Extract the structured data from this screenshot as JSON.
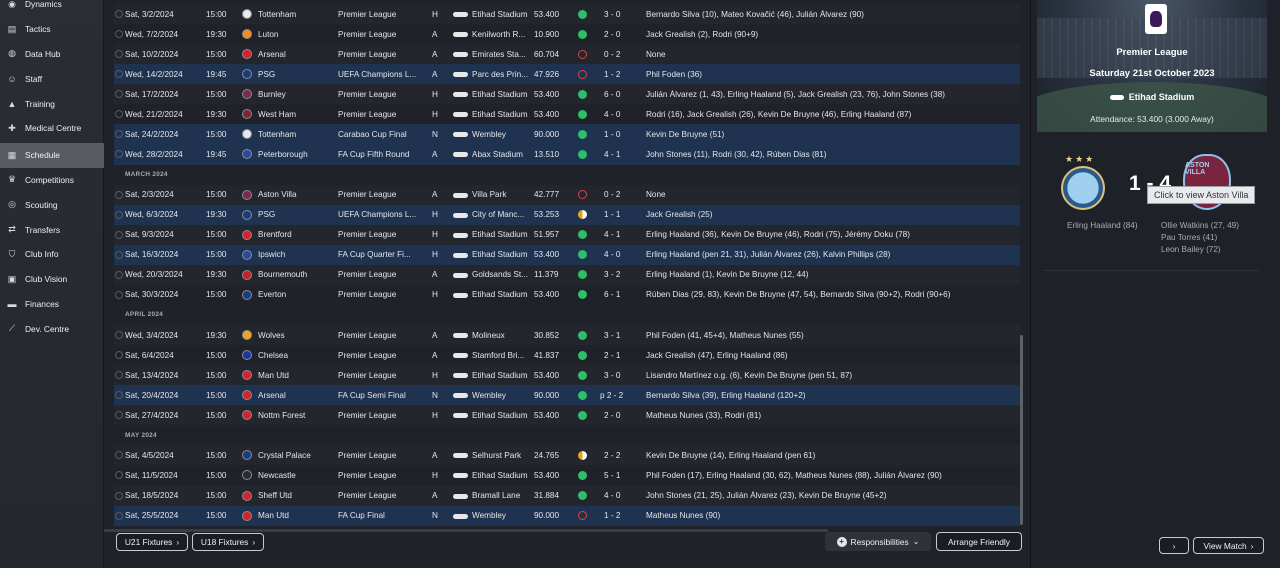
{
  "sidebar": {
    "items": [
      {
        "label": "Dynamics",
        "icon": "dynamics-icon"
      },
      {
        "label": "Tactics",
        "icon": "tactics-icon"
      },
      {
        "label": "Data Hub",
        "icon": "data-hub-icon"
      },
      {
        "label": "Staff",
        "icon": "staff-icon"
      },
      {
        "label": "Training",
        "icon": "training-icon"
      },
      {
        "label": "Medical Centre",
        "icon": "medical-icon"
      },
      {
        "label": "Schedule",
        "icon": "calendar-icon"
      },
      {
        "label": "Competitions",
        "icon": "trophy-icon"
      },
      {
        "label": "Scouting",
        "icon": "scouting-icon"
      },
      {
        "label": "Transfers",
        "icon": "transfers-icon"
      },
      {
        "label": "Club Info",
        "icon": "shield-icon"
      },
      {
        "label": "Club Vision",
        "icon": "vision-icon"
      },
      {
        "label": "Finances",
        "icon": "finances-icon"
      },
      {
        "label": "Dev. Centre",
        "icon": "dev-centre-icon"
      }
    ],
    "active": "Schedule"
  },
  "fixtures": [
    {
      "type": "match",
      "day": "Sat, 3/2/2024",
      "time": "15:00",
      "opp": "Tottenham",
      "comp": "Premier League",
      "ha": "H",
      "stadium": "Etihad Stadium",
      "att": "53.400",
      "result": "W",
      "score": "3 - 0",
      "scorers": "Bernardo Silva (10), Mateo Kovačić (46), Julián Álvarez (90)",
      "crest": "#e8e8f0"
    },
    {
      "type": "match",
      "day": "Wed, 7/2/2024",
      "time": "19:30",
      "opp": "Luton",
      "comp": "Premier League",
      "ha": "A",
      "stadium": "Kenilworth R...",
      "att": "10.900",
      "result": "W",
      "score": "2 - 0",
      "scorers": "Jack Grealish (2), Rodri (90+9)",
      "crest": "#f58a1f"
    },
    {
      "type": "match",
      "day": "Sat, 10/2/2024",
      "time": "15:00",
      "opp": "Arsenal",
      "comp": "Premier League",
      "ha": "A",
      "stadium": "Emirates Sta...",
      "att": "60.704",
      "result": "L",
      "score": "0 - 2",
      "scorers": "None",
      "crest": "#d8202a"
    },
    {
      "type": "match",
      "day": "Wed, 14/2/2024",
      "time": "19:45",
      "opp": "PSG",
      "comp": "UEFA Champions L...",
      "ha": "A",
      "stadium": "Parc des Prin...",
      "att": "47.926",
      "result": "L",
      "score": "1 - 2",
      "scorers": "Phil Foden (36)",
      "crest": "#1c3c78",
      "hl": true
    },
    {
      "type": "match",
      "day": "Sat, 17/2/2024",
      "time": "15:00",
      "opp": "Burnley",
      "comp": "Premier League",
      "ha": "H",
      "stadium": "Etihad Stadium",
      "att": "53.400",
      "result": "W",
      "score": "6 - 0",
      "scorers": "Julián Álvarez (1, 43), Erling Haaland (5), Jack Grealish (23, 76), John Stones (38)",
      "crest": "#7a2a4a"
    },
    {
      "type": "match",
      "day": "Wed, 21/2/2024",
      "time": "19:30",
      "opp": "West Ham",
      "comp": "Premier League",
      "ha": "H",
      "stadium": "Etihad Stadium",
      "att": "53.400",
      "result": "W",
      "score": "4 - 0",
      "scorers": "Rodri (16), Jack Grealish (26), Kevin De Bruyne (46), Erling Haaland (87)",
      "crest": "#7a2636"
    },
    {
      "type": "match",
      "day": "Sat, 24/2/2024",
      "time": "15:00",
      "opp": "Tottenham",
      "comp": "Carabao Cup Final",
      "ha": "N",
      "stadium": "Wembley",
      "att": "90.000",
      "result": "W",
      "score": "1 - 0",
      "scorers": "Kevin De Bruyne (51)",
      "crest": "#e8e8f0",
      "hl": true
    },
    {
      "type": "match",
      "day": "Wed, 28/2/2024",
      "time": "19:45",
      "opp": "Peterborough",
      "comp": "FA Cup Fifth Round",
      "ha": "A",
      "stadium": "Abax Stadium",
      "att": "13.510",
      "result": "W",
      "score": "4 - 1",
      "scorers": "John Stones (11), Rodri (30, 42), Rúben Dias (81)",
      "crest": "#2a4a9a",
      "hl": true
    },
    {
      "type": "month",
      "label": "MARCH 2024"
    },
    {
      "type": "match",
      "day": "Sat, 2/3/2024",
      "time": "15:00",
      "opp": "Aston Villa",
      "comp": "Premier League",
      "ha": "A",
      "stadium": "Villa Park",
      "att": "42.777",
      "result": "L",
      "score": "0 - 2",
      "scorers": "None",
      "crest": "#7a2a4a"
    },
    {
      "type": "match",
      "day": "Wed, 6/3/2024",
      "time": "19:30",
      "opp": "PSG",
      "comp": "UEFA Champions L...",
      "ha": "H",
      "stadium": "City of Manc...",
      "att": "53.253",
      "result": "D",
      "score": "1 - 1",
      "scorers": "Jack Grealish (25)",
      "crest": "#1c3c78",
      "hl": true
    },
    {
      "type": "match",
      "day": "Sat, 9/3/2024",
      "time": "15:00",
      "opp": "Brentford",
      "comp": "Premier League",
      "ha": "H",
      "stadium": "Etihad Stadium",
      "att": "51.957",
      "result": "W",
      "score": "4 - 1",
      "scorers": "Erling Haaland (36), Kevin De Bruyne (46), Rodri (75), Jérémy Doku (78)",
      "crest": "#d8202a"
    },
    {
      "type": "match",
      "day": "Sat, 16/3/2024",
      "time": "15:00",
      "opp": "Ipswich",
      "comp": "FA Cup Quarter Fi...",
      "ha": "H",
      "stadium": "Etihad Stadium",
      "att": "53.400",
      "result": "W",
      "score": "4 - 0",
      "scorers": "Erling Haaland (pen 21, 31), Julián Álvarez (26), Kalvin Phillips (28)",
      "crest": "#2a4aa0",
      "hl": true
    },
    {
      "type": "match",
      "day": "Wed, 20/3/2024",
      "time": "19:30",
      "opp": "Bournemouth",
      "comp": "Premier League",
      "ha": "A",
      "stadium": "Goldsands St...",
      "att": "11.379",
      "result": "W",
      "score": "3 - 2",
      "scorers": "Erling Haaland (1), Kevin De Bruyne (12, 44)",
      "crest": "#c8202a"
    },
    {
      "type": "match",
      "day": "Sat, 30/3/2024",
      "time": "15:00",
      "opp": "Everton",
      "comp": "Premier League",
      "ha": "H",
      "stadium": "Etihad Stadium",
      "att": "53.400",
      "result": "W",
      "score": "6 - 1",
      "scorers": "Rúben Dias (29, 83), Kevin De Bruyne (47, 54), Bernardo Silva (90+2), Rodri (90+6)",
      "crest": "#1a3a8a"
    },
    {
      "type": "month",
      "label": "APRIL 2024"
    },
    {
      "type": "match",
      "day": "Wed, 3/4/2024",
      "time": "19:30",
      "opp": "Wolves",
      "comp": "Premier League",
      "ha": "A",
      "stadium": "Molineux",
      "att": "30.852",
      "result": "W",
      "score": "3 - 1",
      "scorers": "Phil Foden (41, 45+4), Matheus Nunes (55)",
      "crest": "#f2a51a"
    },
    {
      "type": "match",
      "day": "Sat, 6/4/2024",
      "time": "15:00",
      "opp": "Chelsea",
      "comp": "Premier League",
      "ha": "A",
      "stadium": "Stamford Bri...",
      "att": "41.837",
      "result": "W",
      "score": "2 - 1",
      "scorers": "Jack Grealish (47), Erling Haaland (86)",
      "crest": "#1a3aa0"
    },
    {
      "type": "match",
      "day": "Sat, 13/4/2024",
      "time": "15:00",
      "opp": "Man Utd",
      "comp": "Premier League",
      "ha": "H",
      "stadium": "Etihad Stadium",
      "att": "53.400",
      "result": "W",
      "score": "3 - 0",
      "scorers": "Lisandro Martínez o.g. (6), Kevin De Bruyne (pen 51, 87)",
      "crest": "#d8202a"
    },
    {
      "type": "match",
      "day": "Sat, 20/4/2024",
      "time": "15:00",
      "opp": "Arsenal",
      "comp": "FA Cup Semi Final",
      "ha": "N",
      "stadium": "Wembley",
      "att": "90.000",
      "result": "W",
      "score": "p 2 - 2",
      "scorers": "Bernardo Silva (39), Erling Haaland (120+2)",
      "crest": "#d8202a",
      "hl": true
    },
    {
      "type": "match",
      "day": "Sat, 27/4/2024",
      "time": "15:00",
      "opp": "Nottm Forest",
      "comp": "Premier League",
      "ha": "H",
      "stadium": "Etihad Stadium",
      "att": "53.400",
      "result": "W",
      "score": "2 - 0",
      "scorers": "Matheus Nunes (33), Rodri (81)",
      "crest": "#d8202a"
    },
    {
      "type": "month",
      "label": "MAY 2024"
    },
    {
      "type": "match",
      "day": "Sat, 4/5/2024",
      "time": "15:00",
      "opp": "Crystal Palace",
      "comp": "Premier League",
      "ha": "A",
      "stadium": "Selhurst Park",
      "att": "24.765",
      "result": "D",
      "score": "2 - 2",
      "scorers": "Kevin De Bruyne (14), Erling Haaland (pen 61)",
      "crest": "#1a3a8a"
    },
    {
      "type": "match",
      "day": "Sat, 11/5/2024",
      "time": "15:00",
      "opp": "Newcastle",
      "comp": "Premier League",
      "ha": "H",
      "stadium": "Etihad Stadium",
      "att": "53.400",
      "result": "W",
      "score": "5 - 1",
      "scorers": "Phil Foden (17), Erling Haaland (30, 62), Matheus Nunes (88), Julián Álvarez (90)",
      "crest": "#2a2a2a"
    },
    {
      "type": "match",
      "day": "Sat, 18/5/2024",
      "time": "15:00",
      "opp": "Sheff Utd",
      "comp": "Premier League",
      "ha": "A",
      "stadium": "Bramall Lane",
      "att": "31.884",
      "result": "W",
      "score": "4 - 0",
      "scorers": "John Stones (21, 25), Julián Álvarez (23), Kevin De Bruyne (45+2)",
      "crest": "#d8202a"
    },
    {
      "type": "match",
      "day": "Sat, 25/5/2024",
      "time": "15:00",
      "opp": "Man Utd",
      "comp": "FA Cup Final",
      "ha": "N",
      "stadium": "Wembley",
      "att": "90.000",
      "result": "L",
      "score": "1 - 2",
      "scorers": "Matheus Nunes (90)",
      "crest": "#d8202a",
      "hl": true
    }
  ],
  "buttons": {
    "u21": "U21 Fixtures",
    "u18": "U18 Fixtures",
    "responsibilities": "Responsibilities",
    "arrange": "Arrange Friendly",
    "view_match": "View Match",
    "next": "›"
  },
  "match_panel": {
    "competition": "Premier League",
    "date": "Saturday 21st October 2023",
    "stadium": "Etihad Stadium",
    "attendance": "Attendance: 53.400 (3.000 Away)",
    "score": "1 - 4",
    "tooltip": "Click to view Aston Villa",
    "away_badge_text": "ASTON VILLA",
    "home_scorers": [
      "Erling Haaland (84)"
    ],
    "away_scorers": [
      "Ollie Watkins (27, 49)",
      "Pau Torres (41)",
      "Leon Bailey (72)"
    ]
  },
  "colors": {
    "win": "#2fbf6a",
    "loss": "#e4413e",
    "draw": "#e8a21c",
    "highlight": "#1f3350",
    "accent": "#585b61"
  }
}
